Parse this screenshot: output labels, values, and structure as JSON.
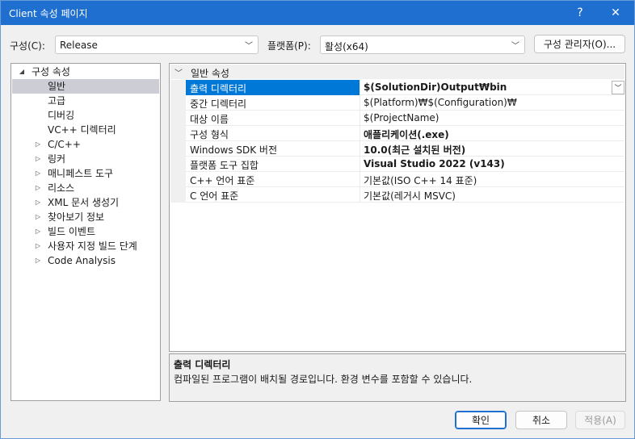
{
  "window": {
    "title": "Client 속성 페이지",
    "help_label": "?",
    "close_label": "✕"
  },
  "toolbar": {
    "config_label": "구성(C):",
    "config_value": "Release",
    "platform_label": "플랫폼(P):",
    "platform_value": "활성(x64)",
    "config_manager_label": "구성 관리자(O)..."
  },
  "tree": {
    "items": [
      {
        "label": "구성 속성",
        "arrow": "◢"
      },
      {
        "label": "일반"
      },
      {
        "label": "고급"
      },
      {
        "label": "디버깅"
      },
      {
        "label": "VC++ 디렉터리"
      },
      {
        "label": "C/C++",
        "arrow": "▷"
      },
      {
        "label": "링커",
        "arrow": "▷"
      },
      {
        "label": "매니페스트 도구",
        "arrow": "▷"
      },
      {
        "label": "리소스",
        "arrow": "▷"
      },
      {
        "label": "XML 문서 생성기",
        "arrow": "▷"
      },
      {
        "label": "찾아보기 정보",
        "arrow": "▷"
      },
      {
        "label": "빌드 이벤트",
        "arrow": "▷"
      },
      {
        "label": "사용자 지정 빌드 단계",
        "arrow": "▷"
      },
      {
        "label": "Code Analysis",
        "arrow": "▷"
      }
    ]
  },
  "grid": {
    "category": "일반 속성",
    "rows": [
      {
        "name": "출력 디렉터리",
        "value": "$(SolutionDir)Output₩bin"
      },
      {
        "name": "중간 디렉터리",
        "value": "$(Platform)₩$(Configuration)₩"
      },
      {
        "name": "대상 이름",
        "value": "$(ProjectName)"
      },
      {
        "name": "구성 형식",
        "value": "애플리케이션(.exe)"
      },
      {
        "name": "Windows SDK 버전",
        "value": "10.0(최근 설치된 버전)"
      },
      {
        "name": "플랫폼 도구 집합",
        "value": "Visual Studio 2022 (v143)"
      },
      {
        "name": "C++ 언어 표준",
        "value": "기본값(ISO C++ 14 표준)"
      },
      {
        "name": "C 언어 표준",
        "value": "기본값(레거시 MSVC)"
      }
    ]
  },
  "description": {
    "title": "출력 디렉터리",
    "text": "컴파일된 프로그램이 배치될 경로입니다. 환경 변수를 포함할 수 있습니다."
  },
  "buttons": {
    "ok": "확인",
    "cancel": "취소",
    "apply": "적용(A)"
  },
  "colors": {
    "titlebar": "#1f6fd1",
    "selection": "#0078d7",
    "tree_selection": "#cdcdd6"
  }
}
